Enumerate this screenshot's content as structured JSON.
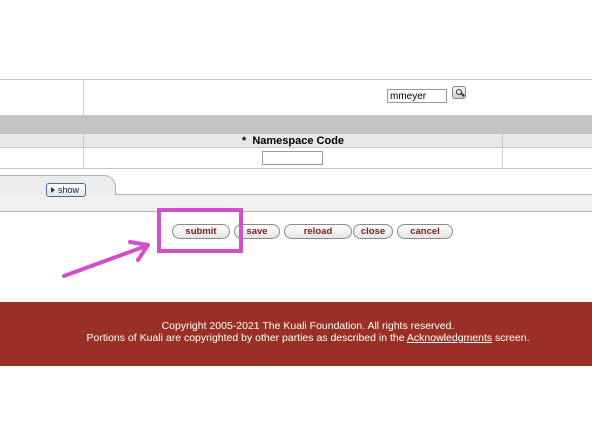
{
  "lookup": {
    "principal_value": "mmeyer",
    "lookup_icon": "magnifier-icon"
  },
  "table": {
    "namespace_header_required": "*",
    "namespace_header": "Namespace Code",
    "namespace_value": ""
  },
  "tab": {
    "show_label": "show"
  },
  "buttons": {
    "submit": "submit",
    "save": "save",
    "reload": "reload",
    "close": "close",
    "cancel": "cancel"
  },
  "annotation": {
    "highlight_color": "#d14fc9"
  },
  "footer": {
    "line1": "Copyright 2005-2021 The Kuali Foundation. All rights reserved.",
    "line2_prefix": "Portions of Kuali are copyrighted by other parties as described in the ",
    "acknowledgments_link": "Acknowledgments",
    "line2_suffix": " screen.",
    "background": "#9a3025"
  }
}
